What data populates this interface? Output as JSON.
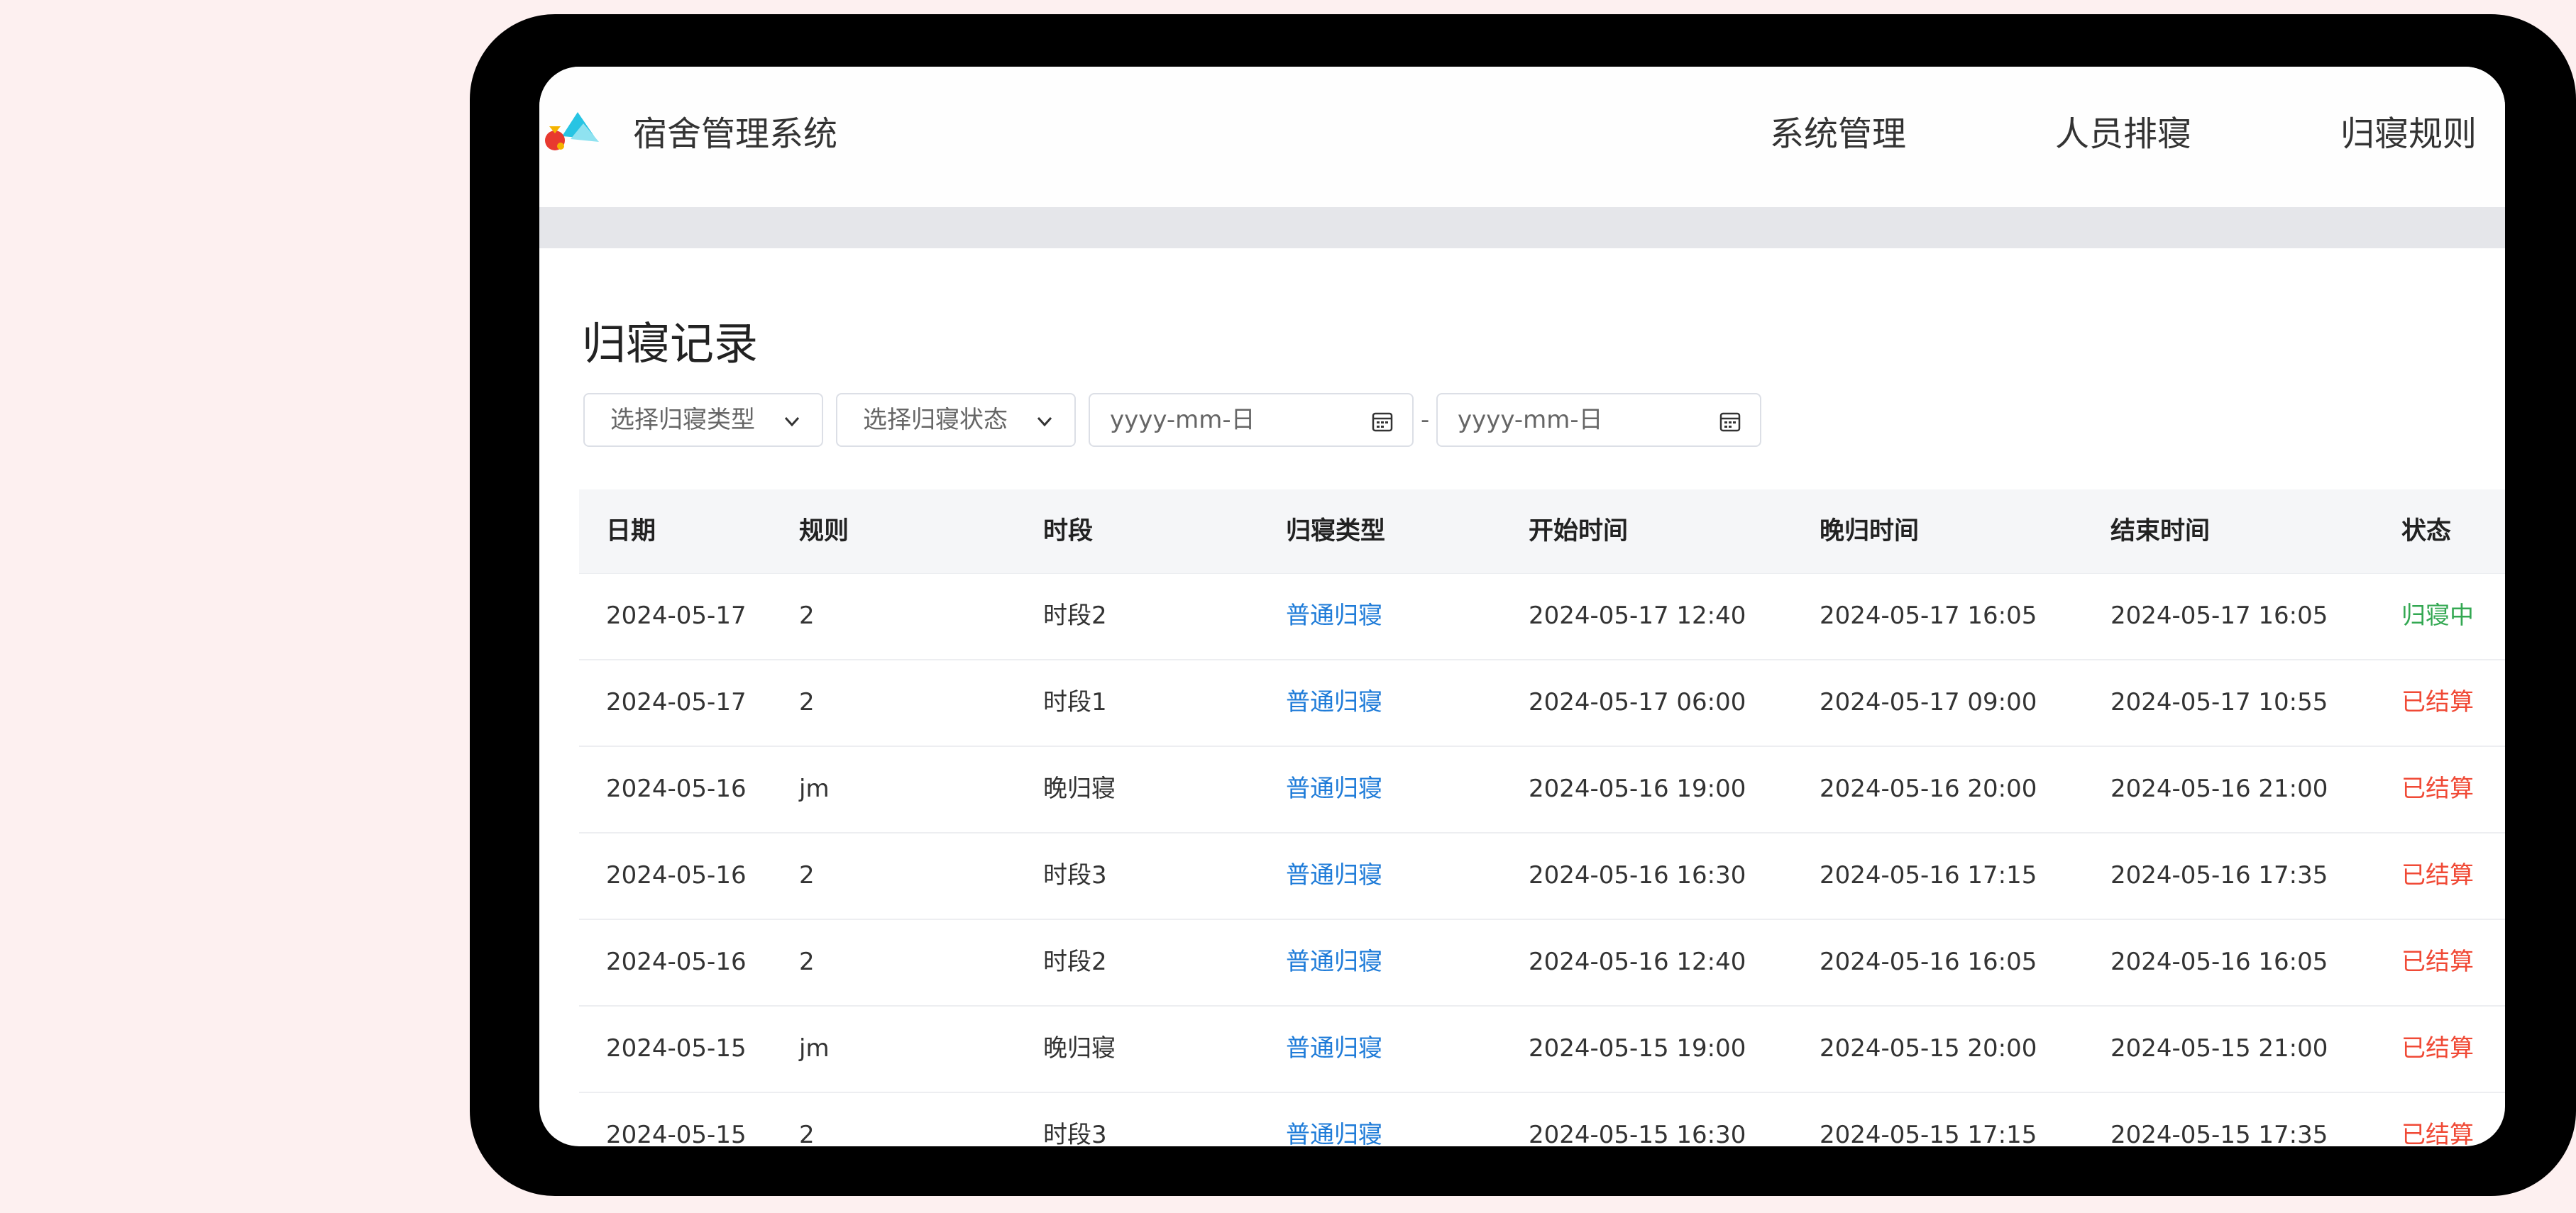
{
  "header": {
    "app_title": "宿舍管理系统",
    "nav": [
      "系统管理",
      "人员排寝",
      "归寝规则"
    ]
  },
  "page": {
    "title": "归寝记录"
  },
  "filters": {
    "type_placeholder": "选择归寝类型",
    "status_placeholder": "选择归寝状态",
    "start_date_placeholder": "yyyy-mm-日",
    "date_separator": "-",
    "end_date_placeholder": "yyyy-mm-日"
  },
  "table": {
    "columns": [
      "日期",
      "规则",
      "时段",
      "归寝类型",
      "开始时间",
      "晚归时间",
      "结束时间",
      "状态"
    ],
    "rows": [
      {
        "date": "2024-05-17",
        "rule": "2",
        "period": "时段2",
        "type": "普通归寝",
        "start": "2024-05-17 12:40",
        "late": "2024-05-17 16:05",
        "end": "2024-05-17 16:05",
        "status": "归寝中",
        "status_kind": "active"
      },
      {
        "date": "2024-05-17",
        "rule": "2",
        "period": "时段1",
        "type": "普通归寝",
        "start": "2024-05-17 06:00",
        "late": "2024-05-17 09:00",
        "end": "2024-05-17 10:55",
        "status": "已结算",
        "status_kind": "done"
      },
      {
        "date": "2024-05-16",
        "rule": "jm",
        "period": "晚归寝",
        "type": "普通归寝",
        "start": "2024-05-16 19:00",
        "late": "2024-05-16 20:00",
        "end": "2024-05-16 21:00",
        "status": "已结算",
        "status_kind": "done"
      },
      {
        "date": "2024-05-16",
        "rule": "2",
        "period": "时段3",
        "type": "普通归寝",
        "start": "2024-05-16 16:30",
        "late": "2024-05-16 17:15",
        "end": "2024-05-16 17:35",
        "status": "已结算",
        "status_kind": "done"
      },
      {
        "date": "2024-05-16",
        "rule": "2",
        "period": "时段2",
        "type": "普通归寝",
        "start": "2024-05-16 12:40",
        "late": "2024-05-16 16:05",
        "end": "2024-05-16 16:05",
        "status": "已结算",
        "status_kind": "done"
      },
      {
        "date": "2024-05-15",
        "rule": "jm",
        "period": "晚归寝",
        "type": "普通归寝",
        "start": "2024-05-15 19:00",
        "late": "2024-05-15 20:00",
        "end": "2024-05-15 21:00",
        "status": "已结算",
        "status_kind": "done"
      },
      {
        "date": "2024-05-15",
        "rule": "2",
        "period": "时段3",
        "type": "普通归寝",
        "start": "2024-05-15 16:30",
        "late": "2024-05-15 17:15",
        "end": "2024-05-15 17:35",
        "status": "已结算",
        "status_kind": "done"
      }
    ]
  },
  "colors": {
    "active_status": "#33a852",
    "done_status": "#f04a36",
    "link": "#1e7bd8"
  },
  "icons": {
    "logo": "app-logo",
    "select_arrow": "chevron-down-icon",
    "date_picker": "calendar-icon"
  }
}
